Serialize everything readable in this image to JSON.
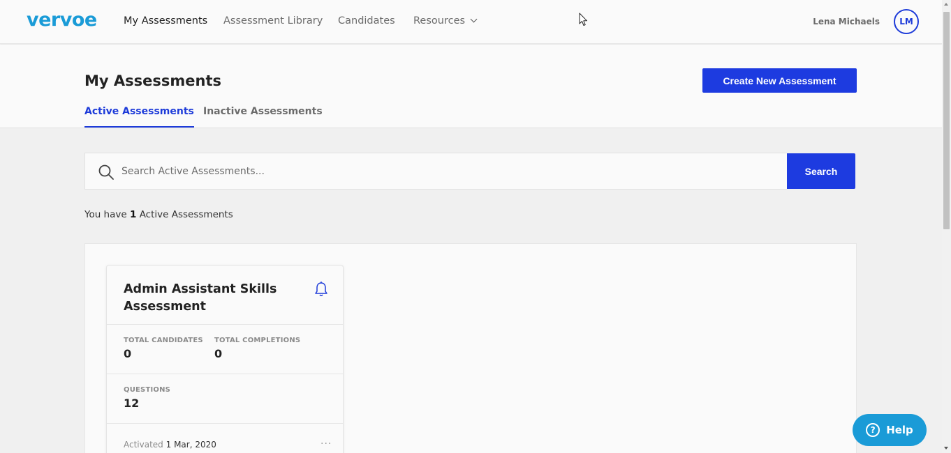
{
  "brand": {
    "logo_text": "vervoe",
    "accent": "#1a9bd7",
    "primary": "#1d3be0"
  },
  "nav": {
    "items": [
      {
        "label": "My Assessments",
        "active": true
      },
      {
        "label": "Assessment Library",
        "active": false
      },
      {
        "label": "Candidates",
        "active": false
      },
      {
        "label": "Resources",
        "active": false,
        "has_dropdown": true
      }
    ],
    "user_name": "Lena Michaels",
    "user_initials": "LM"
  },
  "header": {
    "title": "My Assessments",
    "create_label": "Create New Assessment",
    "tabs": [
      {
        "label": "Active Assessments",
        "active": true
      },
      {
        "label": "Inactive Assessments",
        "active": false
      }
    ]
  },
  "search": {
    "placeholder": "Search Active Assessments...",
    "value": "",
    "button_label": "Search"
  },
  "summary": {
    "prefix": "You have",
    "count": "1",
    "suffix": "Active Assessments"
  },
  "assessments": [
    {
      "title": "Admin Assistant Skills Assessment",
      "total_candidates_label": "TOTAL CANDIDATES",
      "total_candidates": "0",
      "total_completions_label": "TOTAL COMPLETIONS",
      "total_completions": "0",
      "questions_label": "QUESTIONS",
      "questions": "12",
      "activated_label": "Activated",
      "activated_date": "1 Mar, 2020",
      "more_label": "···"
    }
  ],
  "help": {
    "label": "Help",
    "icon_text": "?"
  }
}
